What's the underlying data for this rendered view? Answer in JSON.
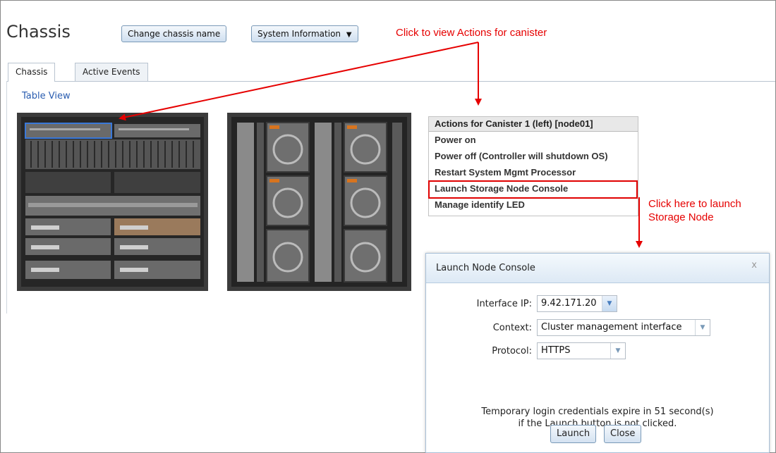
{
  "page": {
    "title": "Chassis"
  },
  "toolbar": {
    "change_name_label": "Change chassis name",
    "system_info_label": "System Information"
  },
  "tabs": [
    {
      "label": "Chassis",
      "active": true
    },
    {
      "label": "Active Events",
      "active": false
    }
  ],
  "table_view_link": "Table View",
  "annotations": {
    "view_actions": "Click to view Actions for canister",
    "launch_line1": "Click here to launch",
    "launch_line2": "Storage Node",
    "color": "#e60000"
  },
  "actions_menu": {
    "title": "Actions for Canister 1 (left) [node01]",
    "items": [
      "Power on",
      "Power off (Controller will shutdown OS)",
      "Restart System Mgmt Processor",
      "Launch Storage Node Console",
      "Manage identify LED"
    ],
    "highlighted_index": 3
  },
  "dialog": {
    "title": "Launch Node Console",
    "close_glyph": "x",
    "interface_ip_label": "Interface IP:",
    "interface_ip_value": "9.42.171.20",
    "context_label": "Context:",
    "context_value": "Cluster management interface",
    "protocol_label": "Protocol:",
    "protocol_value": "HTTPS",
    "message_line1": "Temporary login credentials expire in 51 second(s)",
    "message_line2": "if the Launch button is not clicked.",
    "launch_label": "Launch",
    "close_label": "Close"
  },
  "icons": {
    "dropdown": "chevron-down-icon",
    "close": "close-icon",
    "arrow": "red-arrow"
  }
}
